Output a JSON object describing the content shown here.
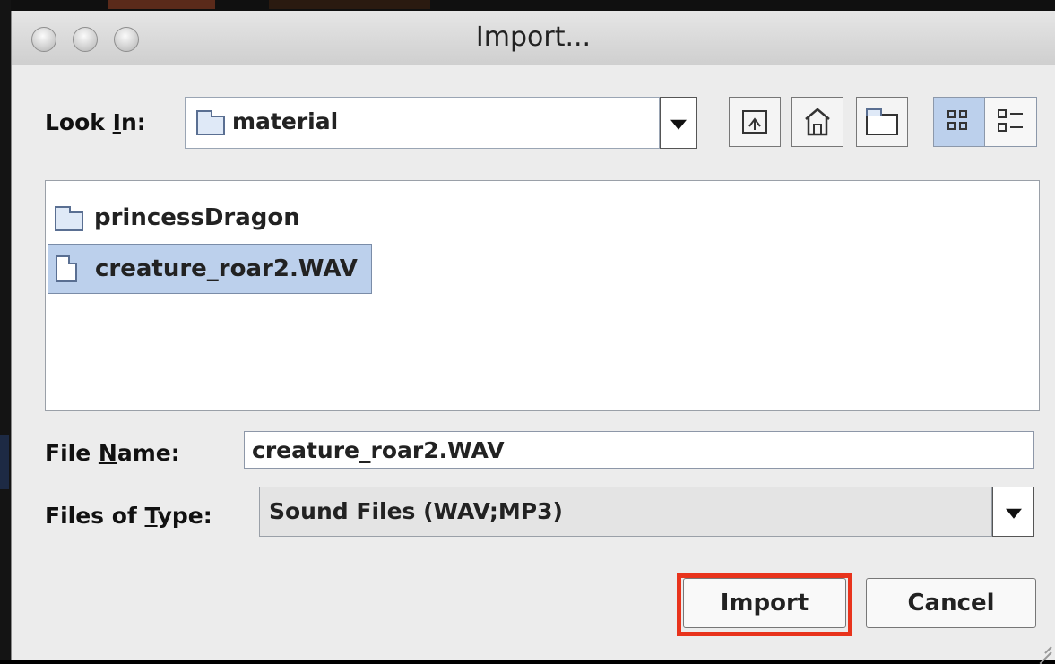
{
  "window": {
    "title": "Import..."
  },
  "look_in": {
    "label_prefix": "Look ",
    "label_mnemonic": "I",
    "label_suffix": "n:",
    "value": "material"
  },
  "toolbar": {
    "icons": [
      "up-folder-icon",
      "home-icon",
      "new-folder-icon",
      "list-view-icon",
      "details-view-icon"
    ]
  },
  "files": [
    {
      "name": "princessDragon",
      "type": "folder",
      "selected": false
    },
    {
      "name": "creature_roar2.WAV",
      "type": "file",
      "selected": true
    }
  ],
  "file_name": {
    "label_prefix": "File ",
    "label_mnemonic": "N",
    "label_suffix": "ame:",
    "value": "creature_roar2.WAV"
  },
  "files_of_type": {
    "label_prefix": "Files of ",
    "label_mnemonic": "T",
    "label_suffix": "ype:",
    "value": "Sound Files (WAV;MP3)"
  },
  "buttons": {
    "import": "Import",
    "cancel": "Cancel"
  },
  "colors": {
    "highlight": "#e8331c",
    "selection": "#bcd0ec"
  }
}
